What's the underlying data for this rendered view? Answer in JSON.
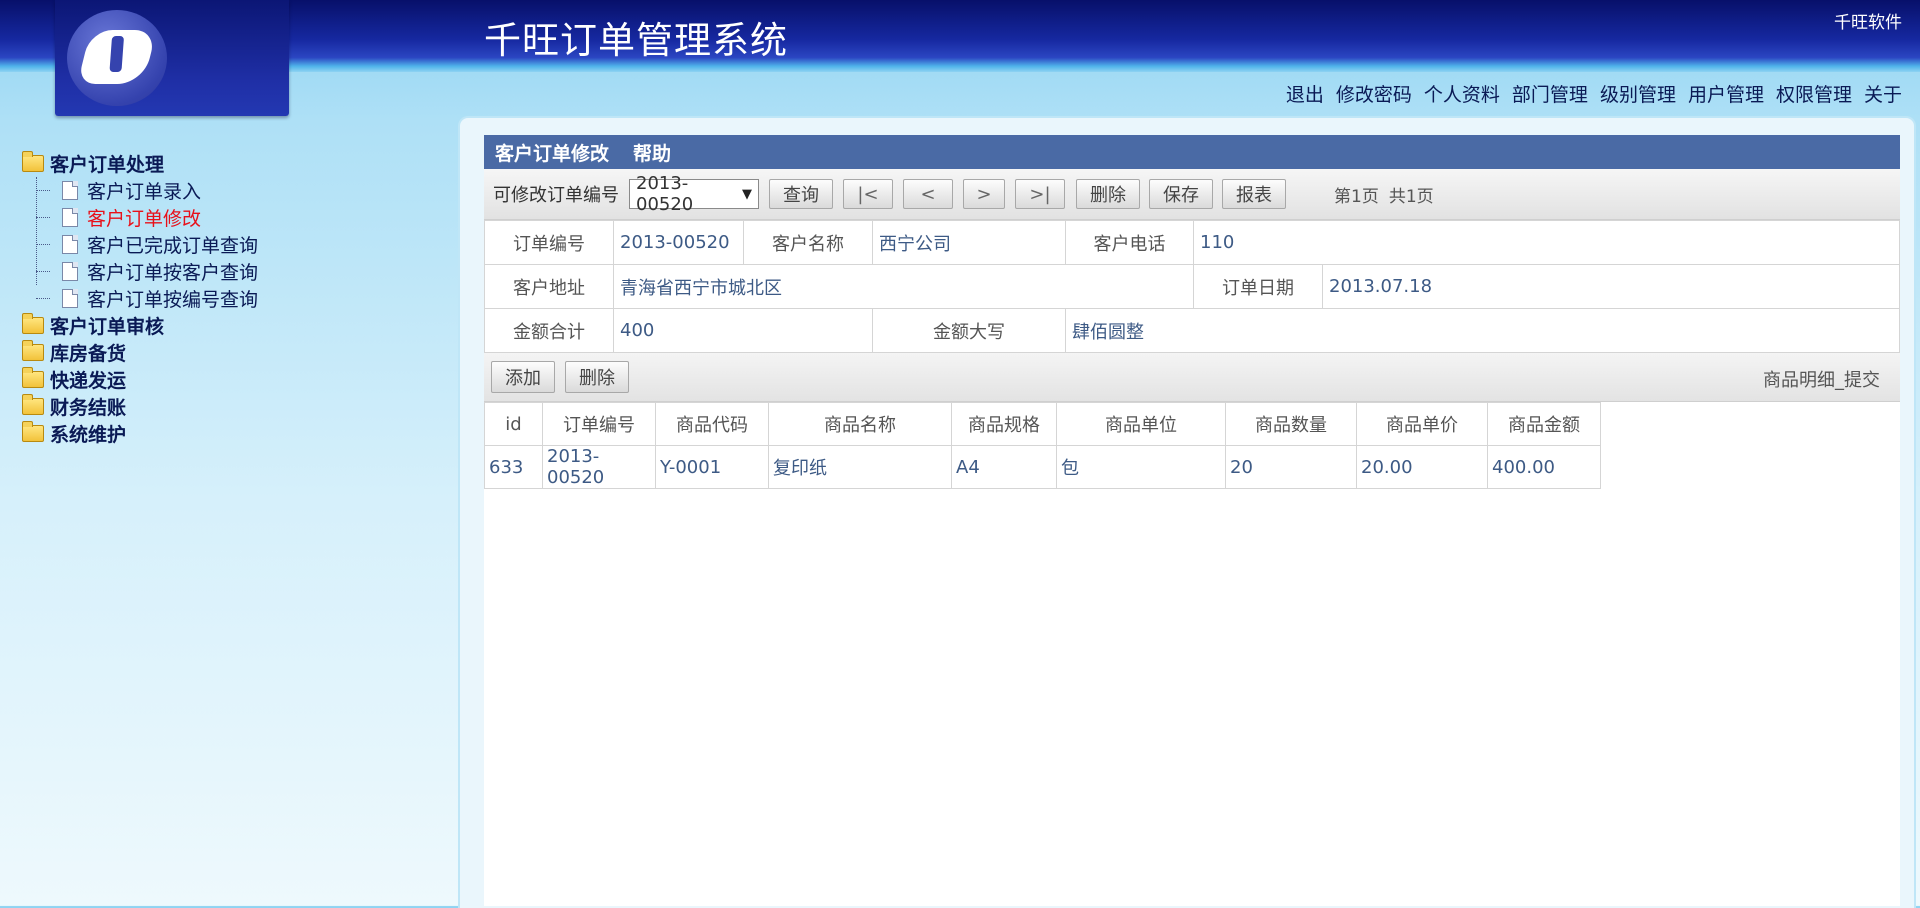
{
  "app": {
    "title": "千旺订单管理系统",
    "vendor": "千旺软件"
  },
  "topnav": [
    "退出",
    "修改密码",
    "个人资料",
    "部门管理",
    "级别管理",
    "用户管理",
    "权限管理",
    "关于"
  ],
  "sidebar": {
    "groups": [
      {
        "label": "客户订单处理",
        "children": [
          "客户订单录入",
          "客户订单修改",
          "客户已完成订单查询",
          "客户订单按客户查询",
          "客户订单按编号查询"
        ],
        "active_child": "客户订单修改"
      },
      {
        "label": "客户订单审核"
      },
      {
        "label": "库房备货"
      },
      {
        "label": "快递发运"
      },
      {
        "label": "财务结账"
      },
      {
        "label": "系统维护"
      }
    ]
  },
  "panel": {
    "title": "客户订单修改",
    "help": "帮助",
    "toolbar": {
      "order_select_label": "可修改订单编号",
      "order_select_value": "2013-00520",
      "query": "查询",
      "first": "|<",
      "prev": "<",
      "next": ">",
      "last": ">|",
      "delete": "删除",
      "save": "保存",
      "report": "报表",
      "page_current": "第1页",
      "page_total": "共1页"
    },
    "form": {
      "order_no_label": "订单编号",
      "order_no": "2013-00520",
      "customer_name_label": "客户名称",
      "customer_name": "西宁公司",
      "customer_phone_label": "客户电话",
      "customer_phone": "110",
      "customer_address_label": "客户地址",
      "customer_address": "青海省西宁市城北区",
      "order_date_label": "订单日期",
      "order_date": "2013.07.18",
      "amount_total_label": "金额合计",
      "amount_total": "400",
      "amount_upper_label": "金额大写",
      "amount_upper": "肆佰圆整"
    },
    "detail_toolbar": {
      "add": "添加",
      "delete": "删除",
      "submit_label": "商品明细_提交"
    },
    "grid": {
      "columns": [
        "id",
        "订单编号",
        "商品代码",
        "商品名称",
        "商品规格",
        "商品单位",
        "商品数量",
        "商品单价",
        "商品金额"
      ],
      "rows": [
        [
          "633",
          "2013-00520",
          "Y-0001",
          "复印纸",
          "A4",
          "包",
          "20",
          "20.00",
          "400.00"
        ]
      ]
    }
  }
}
